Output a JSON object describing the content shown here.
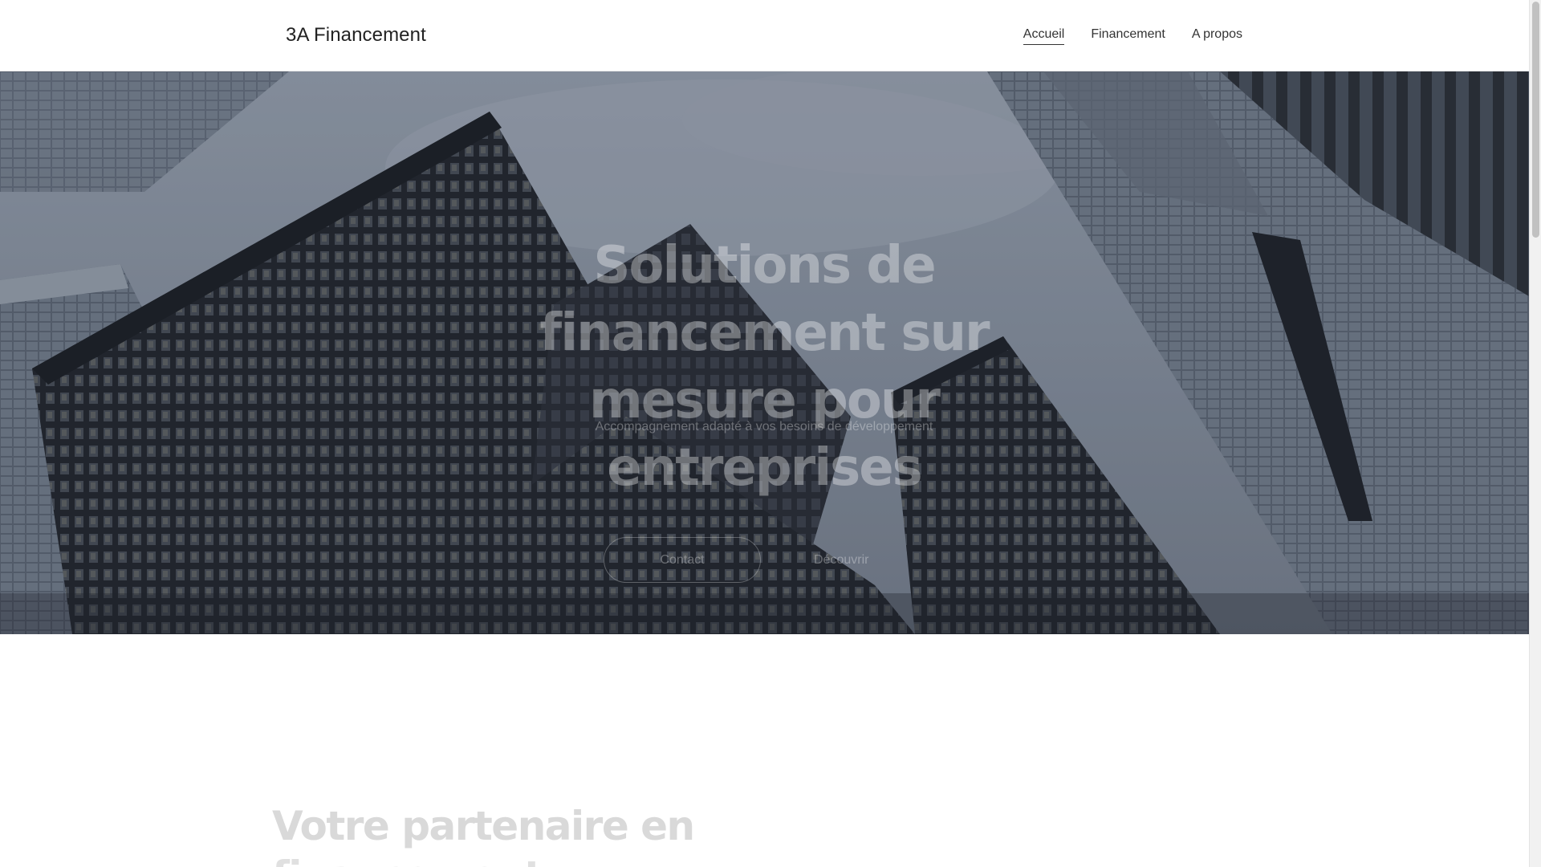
{
  "header": {
    "brand": "3A Financement",
    "nav": [
      {
        "label": "Accueil",
        "active": true
      },
      {
        "label": "Financement",
        "active": false
      },
      {
        "label": "A propos",
        "active": false
      }
    ]
  },
  "hero": {
    "title": "Solutions de financement sur mesure pour entreprises",
    "subtitle": "Accompagnement adapté à vos besoins de développement",
    "contact_button": "Contact",
    "discover_button": "Découvrir"
  },
  "section": {
    "title_line1": "Votre partenaire en",
    "title_line2": "financement"
  }
}
